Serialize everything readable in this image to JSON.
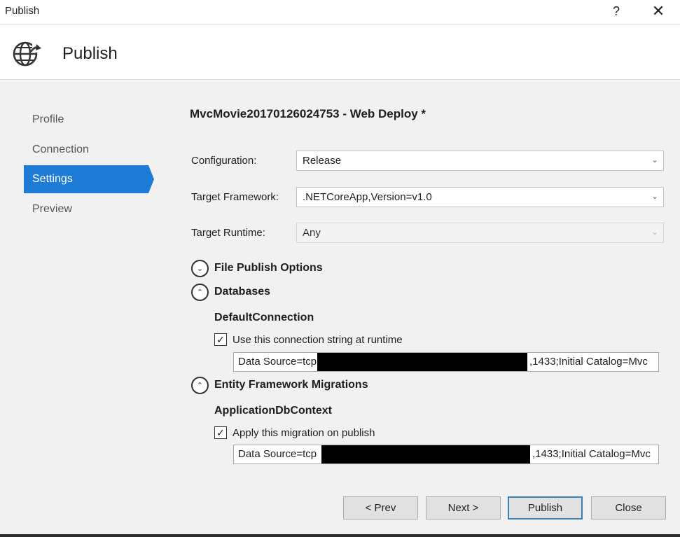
{
  "window": {
    "title": "Publish",
    "help_label": "?",
    "close_label": "✕"
  },
  "header": {
    "icon": "globe-publish-icon",
    "title": "Publish"
  },
  "nav": {
    "items": [
      {
        "label": "Profile",
        "active": false
      },
      {
        "label": "Connection",
        "active": false
      },
      {
        "label": "Settings",
        "active": true
      },
      {
        "label": "Preview",
        "active": false
      }
    ]
  },
  "settings": {
    "profile_title": "MvcMovie20170126024753 - Web Deploy *",
    "configuration": {
      "label": "Configuration:",
      "value": "Release"
    },
    "target_framework": {
      "label": "Target Framework:",
      "value": ".NETCoreApp,Version=v1.0"
    },
    "target_runtime": {
      "label": "Target Runtime:",
      "value": "Any"
    },
    "file_publish_options": {
      "label": "File Publish Options",
      "expanded": false
    },
    "databases": {
      "label": "Databases",
      "expanded": true,
      "connection_name": "DefaultConnection",
      "use_checkbox_label": "Use this connection string at runtime",
      "use_checked": true,
      "conn_prefix": "Data Source=tcp",
      "conn_suffix": ",1433;Initial Catalog=Mvc"
    },
    "ef_migrations": {
      "label": "Entity Framework Migrations",
      "expanded": true,
      "context_name": "ApplicationDbContext",
      "apply_checkbox_label": "Apply this migration on publish",
      "apply_checked": true,
      "conn_prefix": "Data Source=tcp",
      "conn_suffix": ",1433;Initial Catalog=Mvc"
    }
  },
  "footer": {
    "prev_label": "< Prev",
    "next_label": "Next >",
    "publish_label": "Publish",
    "close_label": "Close"
  },
  "glyphs": {
    "chevron_down": "⌄",
    "check": "✓",
    "expand": "⌄",
    "collapse": "⌃"
  }
}
